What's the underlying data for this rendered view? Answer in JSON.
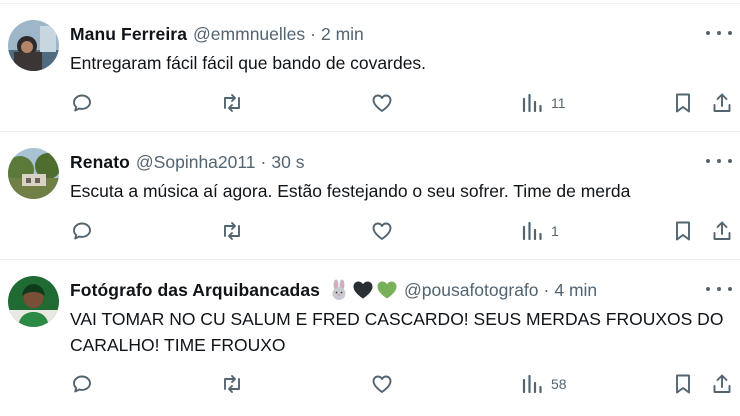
{
  "tweets": [
    {
      "name": "Manu Ferreira",
      "handle": "@emmnuelles",
      "separator": "·",
      "time": "2 min",
      "text": "Entregaram fácil fácil que bando de covardes.",
      "views": "11"
    },
    {
      "name": "Renato",
      "handle": "@Sopinha2011",
      "separator": "·",
      "time": "30 s",
      "text": "Escuta a música aí agora.  Estão festejando o seu sofrer.  Time de merda",
      "views": "1"
    },
    {
      "name": "Fotógrafo das Arquibancadas",
      "name_emojis": [
        "rabbit-emoji",
        "black-heart-emoji",
        "green-heart-emoji"
      ],
      "handle": "@pousafotografo",
      "separator": "·",
      "time": "4 min",
      "text": "VAI TOMAR NO CU SALUM E FRED CASCARDO! SEUS MERDAS FROUXOS DO CARALHO! TIME FROUXO",
      "views": "58"
    }
  ],
  "icons": {
    "reply": "reply-icon",
    "retweet": "retweet-icon",
    "like": "heart-icon",
    "views": "views-bar-chart-icon",
    "bookmark": "bookmark-icon",
    "share": "share-icon",
    "more": "more-dots-icon"
  },
  "colors": {
    "text": "#0f1419",
    "secondary": "#536471",
    "divider": "#e7ecef",
    "background": "#ffffff"
  }
}
